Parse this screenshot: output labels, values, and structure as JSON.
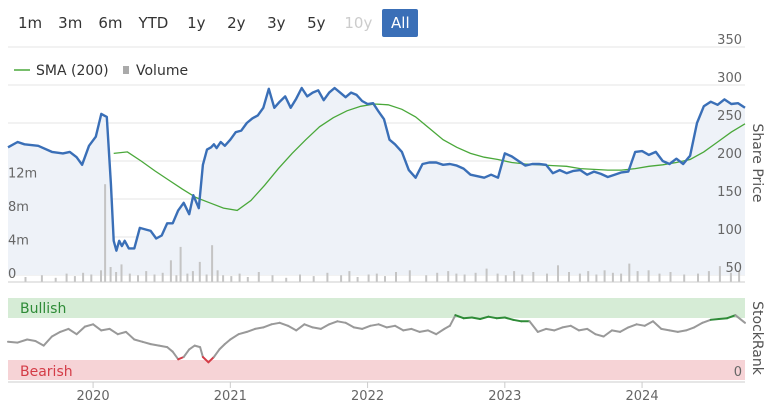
{
  "range_buttons": [
    {
      "label": "1m",
      "state": "normal"
    },
    {
      "label": "3m",
      "state": "normal"
    },
    {
      "label": "6m",
      "state": "normal"
    },
    {
      "label": "YTD",
      "state": "normal"
    },
    {
      "label": "1y",
      "state": "normal"
    },
    {
      "label": "2y",
      "state": "normal"
    },
    {
      "label": "3y",
      "state": "normal"
    },
    {
      "label": "5y",
      "state": "normal"
    },
    {
      "label": "10y",
      "state": "disabled"
    },
    {
      "label": "All",
      "state": "active"
    }
  ],
  "colors": {
    "price_line": "#3a6fb7",
    "price_fill": "#eef2f8",
    "sma_line": "#4aa83a",
    "volume_bar": "#c4c4c4",
    "stockrank_line": "#999999",
    "bullish_band": "#d6ecd6",
    "bearish_band": "#f6d3d6",
    "bullish_text": "#2e8b37",
    "bearish_text": "#d43c47",
    "stockrank_bull": "#2e8b37",
    "stockrank_bear": "#d43c47",
    "active_button": "#3a6fb7"
  },
  "chart_data": [
    {
      "type": "line",
      "title": "",
      "ylabel": "Share Price",
      "ylim": [
        50,
        350
      ],
      "yticks": [
        50,
        100,
        150,
        200,
        250,
        300,
        350
      ],
      "xticks": [
        "2020",
        "2021",
        "2022",
        "2023",
        "2024"
      ],
      "legend": [
        "SMA (200)",
        "Volume"
      ],
      "legend_position": "top-left",
      "grid": true,
      "series": [
        {
          "name": "",
          "x": [
            2019.38,
            2019.45,
            2019.5,
            2019.6,
            2019.7,
            2019.78,
            2019.83,
            2019.88,
            2019.92,
            2019.97,
            2020.02,
            2020.06,
            2020.1,
            2020.13,
            2020.15,
            2020.17,
            2020.19,
            2020.21,
            2020.23,
            2020.26,
            2020.3,
            2020.34,
            2020.38,
            2020.42,
            2020.46,
            2020.5,
            2020.54,
            2020.58,
            2020.62,
            2020.66,
            2020.7,
            2020.73,
            2020.77,
            2020.8,
            2020.83,
            2020.86,
            2020.88,
            2020.9,
            2020.93,
            2020.96,
            2021.0,
            2021.04,
            2021.08,
            2021.12,
            2021.16,
            2021.2,
            2021.24,
            2021.28,
            2021.32,
            2021.36,
            2021.4,
            2021.44,
            2021.48,
            2021.52,
            2021.56,
            2021.6,
            2021.64,
            2021.68,
            2021.72,
            2021.76,
            2021.8,
            2021.84,
            2021.88,
            2021.92,
            2021.96,
            2022.0,
            2022.04,
            2022.08,
            2022.12,
            2022.16,
            2022.2,
            2022.25,
            2022.3,
            2022.35,
            2022.4,
            2022.45,
            2022.5,
            2022.55,
            2022.6,
            2022.65,
            2022.7,
            2022.75,
            2022.8,
            2022.85,
            2022.9,
            2022.95,
            2023.0,
            2023.05,
            2023.1,
            2023.15,
            2023.2,
            2023.25,
            2023.3,
            2023.35,
            2023.4,
            2023.45,
            2023.5,
            2023.55,
            2023.6,
            2023.65,
            2023.7,
            2023.75,
            2023.8,
            2023.85,
            2023.9,
            2023.95,
            2024.0,
            2024.05,
            2024.1,
            2024.15,
            2024.2,
            2024.25,
            2024.3,
            2024.35,
            2024.4,
            2024.45,
            2024.5,
            2024.55,
            2024.6,
            2024.65,
            2024.7,
            2024.75
          ],
          "values": [
            218,
            225,
            222,
            220,
            212,
            210,
            212,
            205,
            195,
            220,
            232,
            262,
            258,
            170,
            95,
            82,
            95,
            88,
            95,
            85,
            85,
            112,
            110,
            108,
            98,
            102,
            118,
            118,
            135,
            145,
            130,
            155,
            138,
            195,
            215,
            218,
            222,
            217,
            225,
            220,
            228,
            238,
            240,
            250,
            256,
            260,
            270,
            295,
            270,
            278,
            285,
            270,
            282,
            296,
            285,
            290,
            293,
            280,
            290,
            296,
            290,
            284,
            290,
            287,
            279,
            275,
            276,
            265,
            255,
            228,
            222,
            212,
            188,
            178,
            196,
            198,
            198,
            195,
            196,
            194,
            190,
            182,
            180,
            178,
            182,
            178,
            210,
            206,
            200,
            194,
            196,
            196,
            195,
            184,
            188,
            184,
            187,
            188,
            182,
            186,
            183,
            179,
            182,
            185,
            186,
            212,
            213,
            208,
            212,
            200,
            196,
            203,
            196,
            207,
            250,
            272,
            278,
            274,
            281,
            275,
            276,
            270
          ]
        },
        {
          "name": "SMA (200)",
          "x": [
            2020.15,
            2020.25,
            2020.35,
            2020.45,
            2020.55,
            2020.65,
            2020.75,
            2020.85,
            2020.95,
            2021.05,
            2021.15,
            2021.25,
            2021.35,
            2021.45,
            2021.55,
            2021.65,
            2021.75,
            2021.85,
            2021.95,
            2022.05,
            2022.15,
            2022.25,
            2022.35,
            2022.45,
            2022.55,
            2022.65,
            2022.75,
            2022.85,
            2022.95,
            2023.05,
            2023.15,
            2023.25,
            2023.35,
            2023.45,
            2023.55,
            2023.65,
            2023.75,
            2023.85,
            2023.95,
            2024.05,
            2024.15,
            2024.25,
            2024.35,
            2024.45,
            2024.55,
            2024.65,
            2024.75
          ],
          "values": [
            210,
            212,
            200,
            187,
            175,
            163,
            152,
            145,
            138,
            135,
            148,
            168,
            190,
            210,
            228,
            245,
            257,
            266,
            272,
            275,
            274,
            268,
            258,
            243,
            228,
            218,
            210,
            205,
            202,
            198,
            196,
            195,
            194,
            193,
            190,
            189,
            188,
            188,
            190,
            193,
            195,
            198,
            202,
            212,
            225,
            238,
            249
          ]
        }
      ],
      "volume": {
        "name": "Volume",
        "axis_ticks": [
          "0",
          "4m",
          "8m",
          "12m"
        ],
        "ylim": [
          0,
          14
        ],
        "x": [
          2019.5,
          2019.62,
          2019.72,
          2019.8,
          2019.86,
          2019.92,
          2019.98,
          2020.05,
          2020.08,
          2020.12,
          2020.16,
          2020.2,
          2020.26,
          2020.32,
          2020.38,
          2020.44,
          2020.5,
          2020.56,
          2020.6,
          2020.63,
          2020.68,
          2020.72,
          2020.77,
          2020.82,
          2020.86,
          2020.9,
          2020.94,
          2021.0,
          2021.06,
          2021.12,
          2021.2,
          2021.3,
          2021.4,
          2021.5,
          2021.6,
          2021.7,
          2021.8,
          2021.86,
          2021.92,
          2022.0,
          2022.06,
          2022.12,
          2022.2,
          2022.3,
          2022.42,
          2022.5,
          2022.58,
          2022.64,
          2022.7,
          2022.78,
          2022.86,
          2022.94,
          2023.0,
          2023.06,
          2023.12,
          2023.2,
          2023.3,
          2023.38,
          2023.46,
          2023.54,
          2023.6,
          2023.66,
          2023.72,
          2023.78,
          2023.84,
          2023.9,
          2023.96,
          2024.04,
          2024.12,
          2024.2,
          2024.3,
          2024.4,
          2024.48,
          2024.56,
          2024.64,
          2024.7
        ],
        "values": [
          0.6,
          0.8,
          0.5,
          1.0,
          0.7,
          1.1,
          0.9,
          1.4,
          11.7,
          1.8,
          1.2,
          2.1,
          1.0,
          0.8,
          1.3,
          0.9,
          1.1,
          2.6,
          0.8,
          4.2,
          1.0,
          1.3,
          2.4,
          0.9,
          4.4,
          1.4,
          0.8,
          0.7,
          1.0,
          0.6,
          1.2,
          0.8,
          0.5,
          0.9,
          0.7,
          1.1,
          0.8,
          1.3,
          0.6,
          0.9,
          1.0,
          0.7,
          1.2,
          1.4,
          0.8,
          1.1,
          1.3,
          1.0,
          0.9,
          1.1,
          1.6,
          1.0,
          0.8,
          1.3,
          0.9,
          1.2,
          1.0,
          2.0,
          1.2,
          1.0,
          1.3,
          0.9,
          1.4,
          1.1,
          1.0,
          2.2,
          1.3,
          1.4,
          1.0,
          1.2,
          0.9,
          1.0,
          1.3,
          1.9,
          1.1,
          1.3
        ]
      }
    },
    {
      "type": "line",
      "title": "",
      "ylabel": "StockRank",
      "ylim": [
        0,
        100
      ],
      "zones": [
        "Bullish",
        "Bearish"
      ],
      "axis_tick": "0",
      "series": [
        {
          "name": "",
          "x": [
            2019.38,
            2019.45,
            2019.52,
            2019.58,
            2019.64,
            2019.7,
            2019.76,
            2019.82,
            2019.88,
            2019.94,
            2020.0,
            2020.06,
            2020.12,
            2020.18,
            2020.24,
            2020.3,
            2020.36,
            2020.42,
            2020.48,
            2020.54,
            2020.58,
            2020.62,
            2020.66,
            2020.7,
            2020.74,
            2020.78,
            2020.8,
            2020.84,
            2020.88,
            2020.92,
            2020.96,
            2021.0,
            2021.06,
            2021.12,
            2021.18,
            2021.24,
            2021.3,
            2021.36,
            2021.42,
            2021.48,
            2021.54,
            2021.6,
            2021.66,
            2021.72,
            2021.78,
            2021.84,
            2021.9,
            2021.96,
            2022.02,
            2022.08,
            2022.14,
            2022.2,
            2022.26,
            2022.32,
            2022.38,
            2022.44,
            2022.5,
            2022.56,
            2022.6,
            2022.64,
            2022.7,
            2022.76,
            2022.82,
            2022.88,
            2022.94,
            2023.0,
            2023.06,
            2023.12,
            2023.18,
            2023.24,
            2023.3,
            2023.36,
            2023.42,
            2023.48,
            2023.54,
            2023.6,
            2023.66,
            2023.72,
            2023.78,
            2023.84,
            2023.9,
            2023.96,
            2024.02,
            2024.08,
            2024.14,
            2024.2,
            2024.26,
            2024.32,
            2024.38,
            2024.44,
            2024.5,
            2024.56,
            2024.62,
            2024.68,
            2024.75
          ],
          "values": [
            45,
            44,
            48,
            46,
            40,
            52,
            58,
            62,
            55,
            65,
            68,
            60,
            62,
            55,
            58,
            48,
            45,
            42,
            40,
            38,
            32,
            22,
            25,
            35,
            40,
            38,
            25,
            18,
            25,
            35,
            42,
            48,
            55,
            58,
            62,
            64,
            68,
            70,
            66,
            60,
            68,
            64,
            62,
            68,
            72,
            70,
            64,
            62,
            66,
            68,
            64,
            66,
            60,
            62,
            58,
            60,
            55,
            62,
            66,
            80,
            76,
            77,
            75,
            78,
            76,
            77,
            74,
            72,
            72,
            58,
            62,
            60,
            64,
            66,
            60,
            62,
            55,
            52,
            60,
            58,
            64,
            68,
            66,
            72,
            62,
            60,
            58,
            60,
            64,
            70,
            74,
            75,
            76,
            80,
            70
          ]
        }
      ]
    }
  ]
}
